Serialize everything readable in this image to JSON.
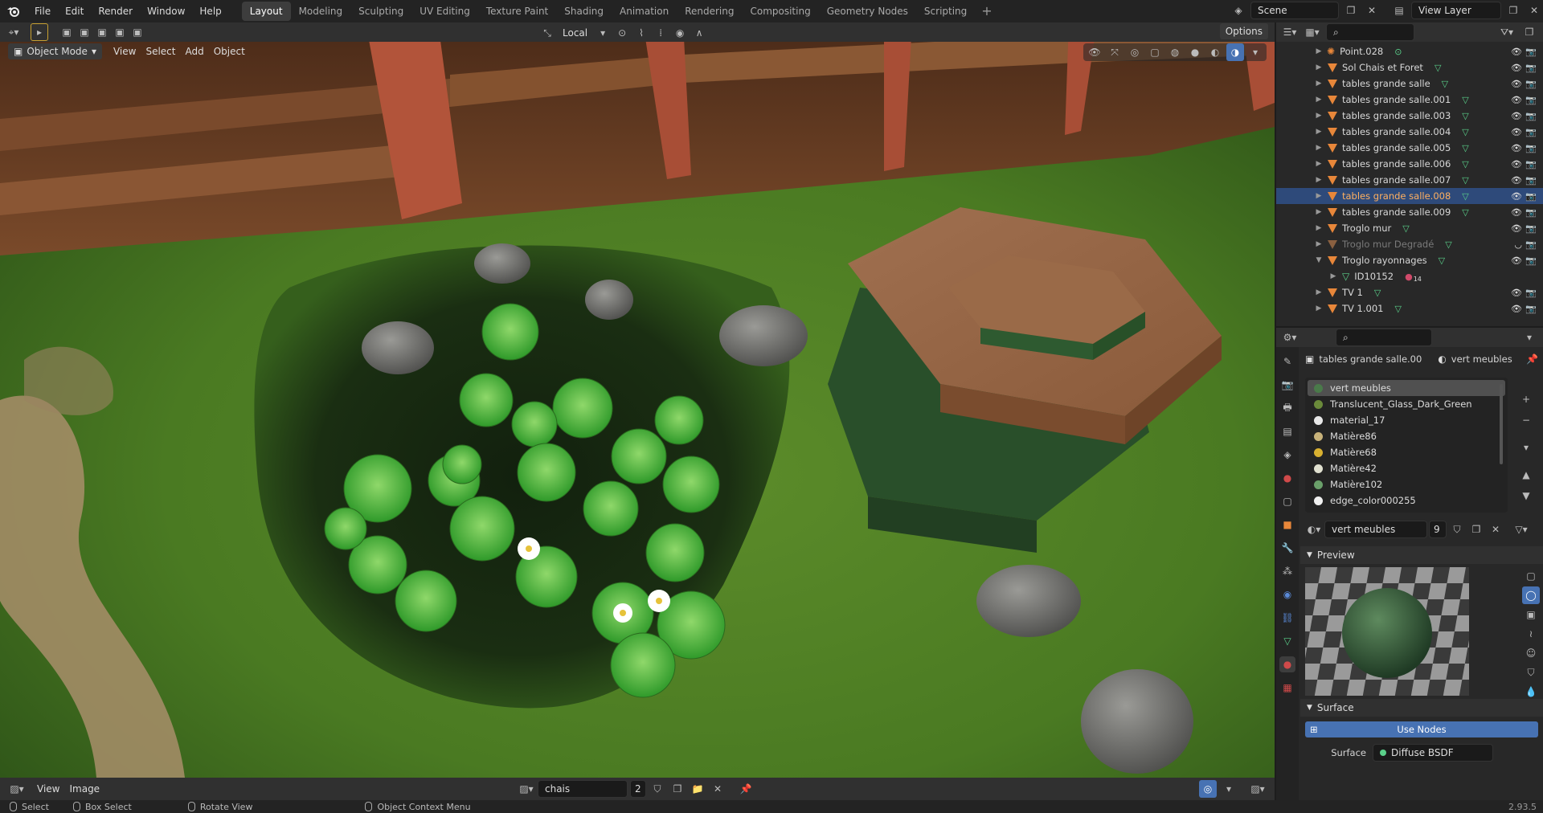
{
  "menubar": {
    "items": [
      "File",
      "Edit",
      "Render",
      "Window",
      "Help"
    ]
  },
  "workspaces": {
    "tabs": [
      "Layout",
      "Modeling",
      "Sculpting",
      "UV Editing",
      "Texture Paint",
      "Shading",
      "Animation",
      "Rendering",
      "Compositing",
      "Geometry Nodes",
      "Scripting"
    ],
    "active": "Layout"
  },
  "scene": {
    "name": "Scene",
    "view_layer": "View Layer"
  },
  "viewport": {
    "mode": "Object Mode",
    "menus": [
      "View",
      "Select",
      "Add",
      "Object"
    ],
    "orientation": "Local",
    "options_label": "Options"
  },
  "outliner": {
    "rows": [
      {
        "label": "Point.028",
        "type": "light",
        "selected": false,
        "dim": false,
        "indent": 0,
        "expanded": false
      },
      {
        "label": "Sol Chais et Foret",
        "type": "object",
        "selected": false,
        "dim": false,
        "indent": 0,
        "expanded": false
      },
      {
        "label": "tables grande salle",
        "type": "object",
        "selected": false,
        "dim": false,
        "indent": 0,
        "expanded": false
      },
      {
        "label": "tables grande salle.001",
        "type": "object",
        "selected": false,
        "dim": false,
        "indent": 0,
        "expanded": false
      },
      {
        "label": "tables grande salle.003",
        "type": "object",
        "selected": false,
        "dim": false,
        "indent": 0,
        "expanded": false
      },
      {
        "label": "tables grande salle.004",
        "type": "object",
        "selected": false,
        "dim": false,
        "indent": 0,
        "expanded": false
      },
      {
        "label": "tables grande salle.005",
        "type": "object",
        "selected": false,
        "dim": false,
        "indent": 0,
        "expanded": false
      },
      {
        "label": "tables grande salle.006",
        "type": "object",
        "selected": false,
        "dim": false,
        "indent": 0,
        "expanded": false
      },
      {
        "label": "tables grande salle.007",
        "type": "object",
        "selected": false,
        "dim": false,
        "indent": 0,
        "expanded": false
      },
      {
        "label": "tables grande salle.008",
        "type": "object",
        "selected": true,
        "dim": false,
        "indent": 0,
        "expanded": false
      },
      {
        "label": "tables grande salle.009",
        "type": "object",
        "selected": false,
        "dim": false,
        "indent": 0,
        "expanded": false
      },
      {
        "label": "Troglo mur",
        "type": "object",
        "selected": false,
        "dim": false,
        "indent": 0,
        "expanded": false
      },
      {
        "label": "Troglo mur Degradé",
        "type": "object",
        "selected": false,
        "dim": true,
        "indent": 0,
        "expanded": false
      },
      {
        "label": "Troglo rayonnages",
        "type": "object",
        "selected": false,
        "dim": false,
        "indent": 0,
        "expanded": true
      },
      {
        "label": "ID10152",
        "type": "mesh",
        "selected": false,
        "dim": false,
        "indent": 1,
        "expanded": false,
        "badge": "14"
      },
      {
        "label": "TV 1",
        "type": "object",
        "selected": false,
        "dim": false,
        "indent": 0,
        "expanded": false
      },
      {
        "label": "TV 1.001",
        "type": "object",
        "selected": false,
        "dim": false,
        "indent": 0,
        "expanded": false
      }
    ]
  },
  "properties": {
    "object_name": "tables grande salle.00",
    "material_name": "vert meubles",
    "materials": [
      {
        "name": "vert meubles",
        "color": "#4a7a4a",
        "selected": true
      },
      {
        "name": "Translucent_Glass_Dark_Green",
        "color": "#6a8a3a",
        "selected": false
      },
      {
        "name": "material_17",
        "color": "#e8e8e8",
        "selected": false
      },
      {
        "name": "Matière86",
        "color": "#c8b27a",
        "selected": false
      },
      {
        "name": "Matière68",
        "color": "#d8b030",
        "selected": false
      },
      {
        "name": "Matière42",
        "color": "#e0e0d0",
        "selected": false
      },
      {
        "name": "Matière102",
        "color": "#6aa06a",
        "selected": false
      },
      {
        "name": "edge_color000255",
        "color": "#f0f0f0",
        "selected": false
      }
    ],
    "slot_material": "vert meubles",
    "user_count": "9",
    "preview_label": "Preview",
    "surface_label": "Surface",
    "use_nodes_label": "Use Nodes",
    "surface_field_label": "Surface",
    "surface_shader": "Diffuse BSDF"
  },
  "image_editor": {
    "menus": [
      "View",
      "Image"
    ],
    "image_name": "chais plafond.jpg",
    "user_count": "2"
  },
  "statusbar": {
    "items": [
      "Select",
      "Box Select",
      "Rotate View",
      "Object Context Menu"
    ],
    "version": "2.93.5"
  },
  "colors": {
    "accent": "#4772b3",
    "selected_row": "#2e4a7a",
    "object_icon": "#e8873a",
    "mesh_icon": "#5ad08a"
  }
}
